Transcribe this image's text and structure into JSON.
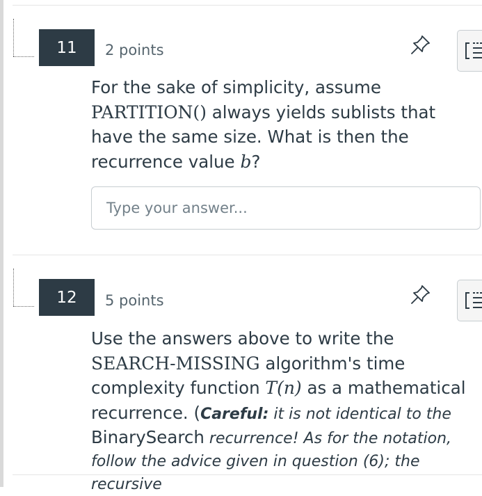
{
  "questions": [
    {
      "number": "11",
      "points": "2 points",
      "text_1": "For the sake of simplicity, assume ",
      "math_1": "PARTITION()",
      "text_2": " always yields sublists that have the same size. What is then the recurrence value ",
      "math_2": "b",
      "text_3": "?",
      "answer_placeholder": "Type your answer..."
    },
    {
      "number": "12",
      "points": "5 points",
      "line1": "Use the answers above to write the",
      "math_1": "SEARCH-MISSING",
      "text_1": " algorithm's time",
      "text_2": "complexity function ",
      "math_2": "T(n)",
      "text_3": " as a mathematical",
      "text_4": "recurrence. (",
      "careful": "Careful:",
      "italic_1": " it is not identical to the",
      "text_5": "BinarySearch",
      "italic_2": " recurrence! As for the notation,",
      "italic_3": "follow the advice given in question (6); the recursive"
    }
  ],
  "icons": {
    "pin": "pin-icon",
    "list": "question-list-icon"
  }
}
